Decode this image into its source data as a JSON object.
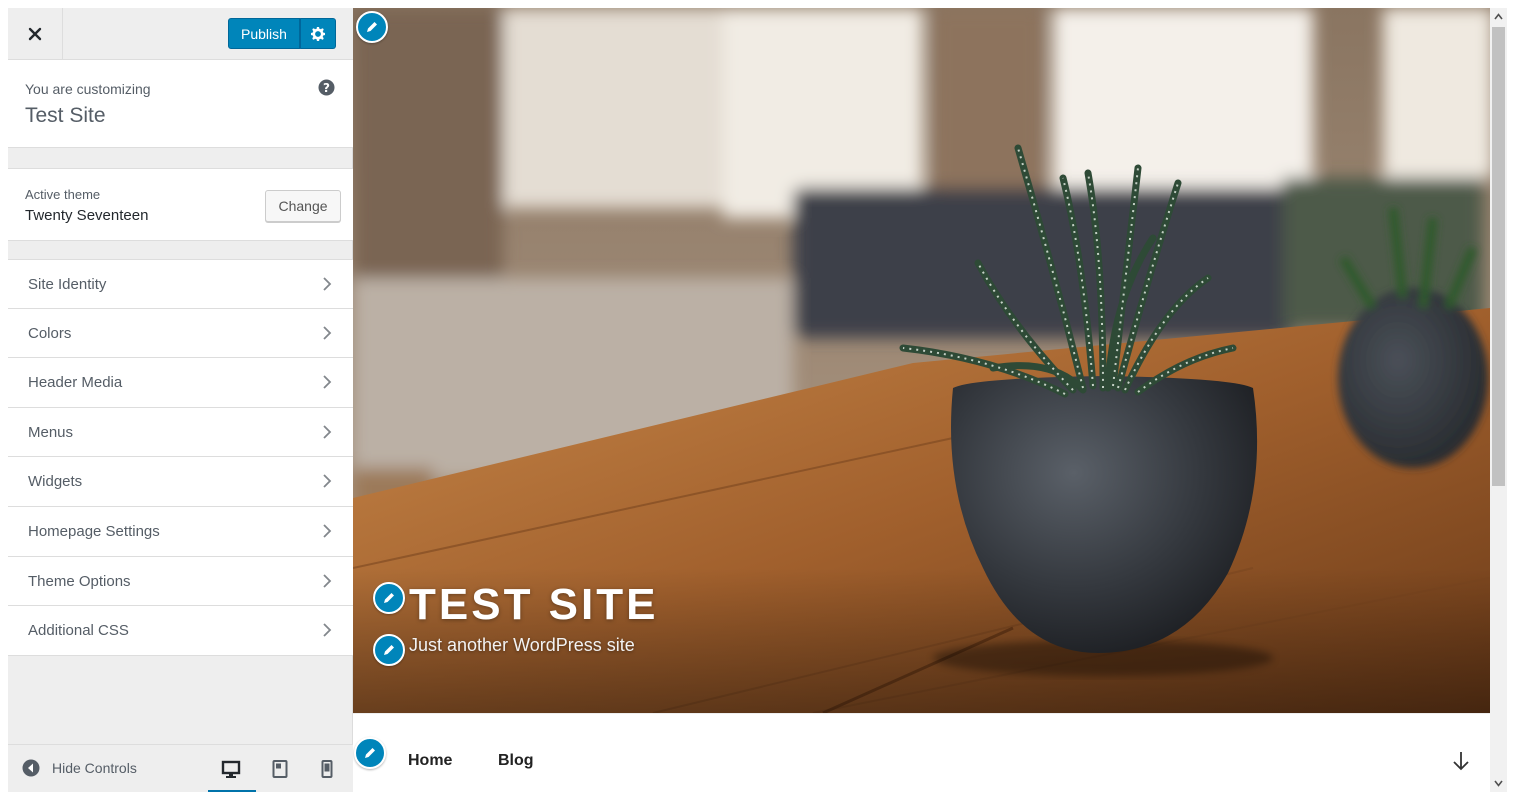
{
  "topbar": {
    "close_icon": "close-icon",
    "publish_label": "Publish",
    "settings_icon": "gear-icon"
  },
  "info": {
    "customizing_label": "You are customizing",
    "site_title": "Test Site",
    "help_icon": "help-icon"
  },
  "theme": {
    "label": "Active theme",
    "name": "Twenty Seventeen",
    "change_label": "Change"
  },
  "sections": [
    {
      "label": "Site Identity"
    },
    {
      "label": "Colors"
    },
    {
      "label": "Header Media"
    },
    {
      "label": "Menus"
    },
    {
      "label": "Widgets"
    },
    {
      "label": "Homepage Settings"
    },
    {
      "label": "Theme Options"
    },
    {
      "label": "Additional CSS"
    }
  ],
  "footer": {
    "hide_controls_label": "Hide Controls",
    "devices": [
      "desktop-icon",
      "tablet-icon",
      "mobile-icon"
    ],
    "active_device": "desktop"
  },
  "preview": {
    "site_title": "TEST SITE",
    "tagline": "Just another WordPress site",
    "nav": [
      "Home",
      "Blog"
    ],
    "scroll_icon": "arrow-down-icon"
  },
  "colors": {
    "accent": "#0085ba",
    "sidebar_bg": "#eeeeee",
    "text": "#555d66"
  }
}
